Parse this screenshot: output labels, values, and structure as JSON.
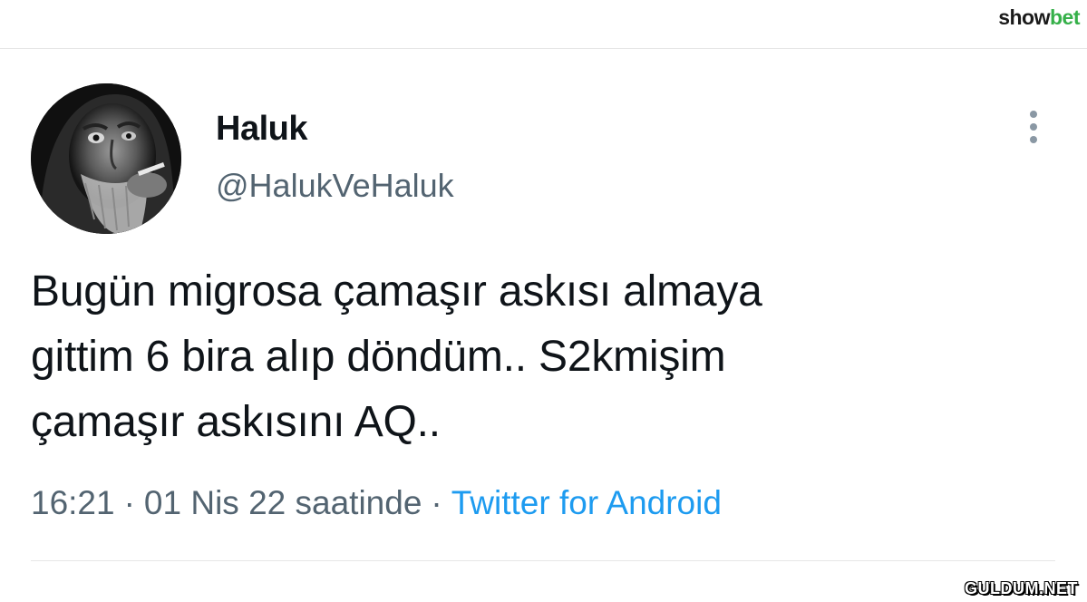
{
  "brand": {
    "part1": "show",
    "part2": "bet"
  },
  "tweet": {
    "avatar_alt": "avatar",
    "display_name": "Haluk",
    "handle": "@HalukVeHaluk",
    "text_lines": [
      "Bugün migrosa çamaşır askısı almaya",
      "gittim 6 bira alıp döndüm.. S2kmişim",
      "çamaşır askısını AQ.."
    ],
    "time": "16:21",
    "date": "01 Nis 22 saatinde",
    "separator": "·",
    "source": "Twitter for Android"
  },
  "more_menu_icon": "vertical-ellipsis-icon",
  "watermark": "GULDUM.NET",
  "colors": {
    "text_primary": "#0f1419",
    "text_secondary": "#536471",
    "link_blue": "#1d9bf0",
    "brand_green": "#35b049"
  }
}
